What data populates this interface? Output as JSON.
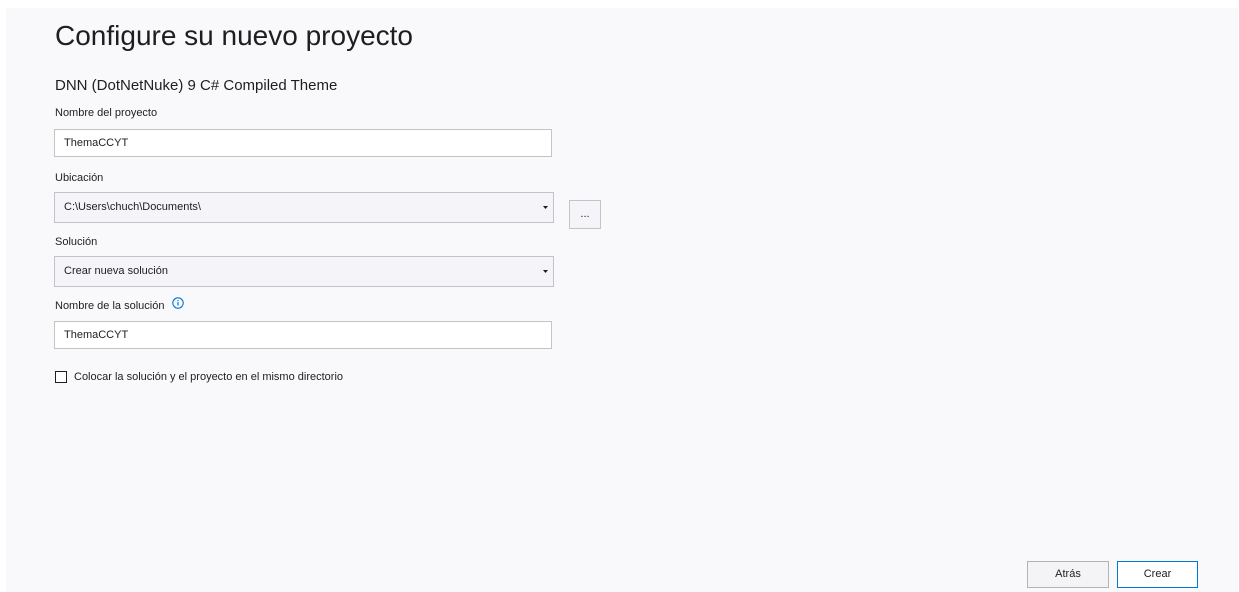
{
  "header": {
    "title": "Configure su nuevo proyecto",
    "template_name": "DNN (DotNetNuke) 9 C# Compiled Theme"
  },
  "form": {
    "project_name": {
      "label": "Nombre del proyecto",
      "value": "ThemaCCYT"
    },
    "location": {
      "label": "Ubicación",
      "value": "C:\\Users\\chuch\\Documents\\",
      "browse_label": "..."
    },
    "solution": {
      "label": "Solución",
      "value": "Crear nueva solución"
    },
    "solution_name": {
      "label": "Nombre de la solución",
      "value": "ThemaCCYT",
      "info_icon": "info-icon"
    },
    "same_directory": {
      "label": "Colocar la solución y el proyecto en el mismo directorio",
      "checked": false
    }
  },
  "footer": {
    "back_label": "Atrás",
    "create_label": "Crear"
  },
  "colors": {
    "accent": "#0078d4",
    "background": "#f9f9fb",
    "border": "#c4c4c4"
  }
}
